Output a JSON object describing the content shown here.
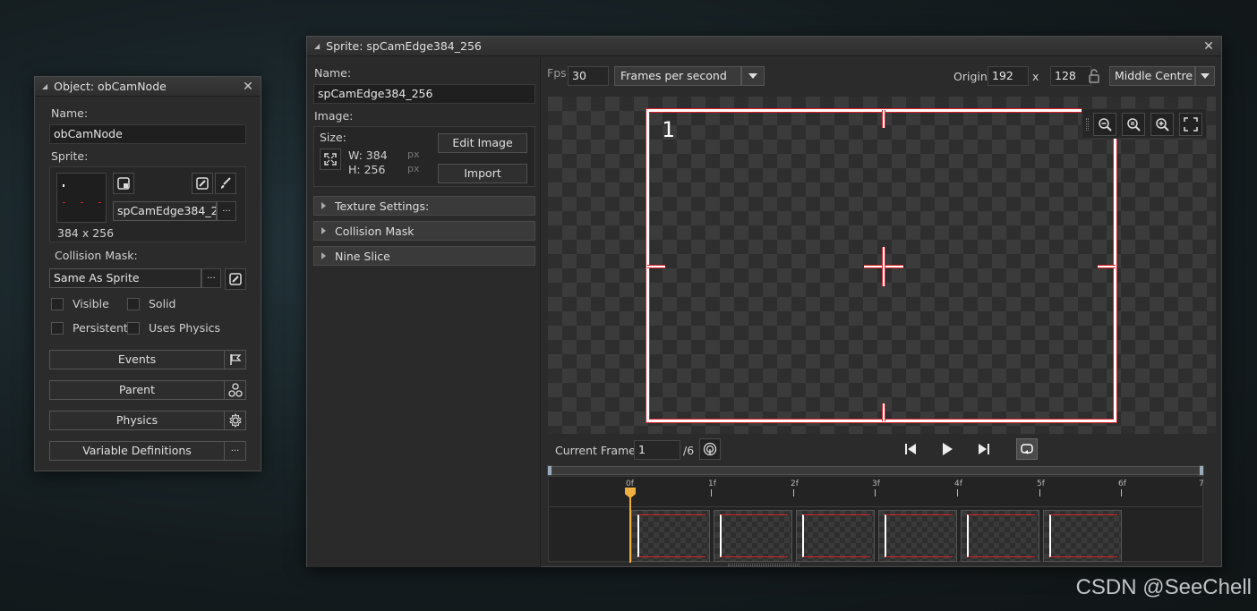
{
  "object_window": {
    "title": "Object: obCamNode",
    "name_label": "Name:",
    "name_value": "obCamNode",
    "sprite_label": "Sprite:",
    "sprite_name": "spCamEdge384_2...",
    "sprite_size": "384 x 256",
    "collision_mask_label": "Collision Mask:",
    "collision_mask_value": "Same As Sprite",
    "checkboxes": {
      "visible": "Visible",
      "solid": "Solid",
      "persistent": "Persistent",
      "uses_physics": "Uses Physics"
    },
    "buttons": {
      "events": "Events",
      "parent": "Parent",
      "physics": "Physics",
      "variable_definitions": "Variable Definitions"
    },
    "ellipsis": "···"
  },
  "sprite_window": {
    "title": "Sprite: spCamEdge384_256",
    "name_label": "Name:",
    "name_value": "spCamEdge384_256",
    "image_label": "Image:",
    "size_label": "Size:",
    "width_text": "W: 384",
    "height_text": "H: 256",
    "px_unit": "px",
    "edit_image": "Edit Image",
    "import": "Import",
    "sections": {
      "texture": "Texture Settings:",
      "collision": "Collision Mask",
      "nine_slice": "Nine Slice"
    },
    "fps_label": "Fps",
    "fps_value": "30",
    "fps_mode": "Frames per second",
    "origin_label": "Origin",
    "origin_x": "192",
    "origin_sep": "x",
    "origin_y": "128",
    "origin_preset": "Middle Centre",
    "frame_number": "1",
    "current_frame_label": "Current Frame:",
    "current_frame_value": "1",
    "frame_total": "/6",
    "timeline_labels": {
      "t0": "0f",
      "t1": "1f",
      "t2": "2f",
      "t3": "3f",
      "t4": "4f",
      "t5": "5f",
      "t6": "6f",
      "t7": "7"
    },
    "frame_count": 6,
    "current_frame_progress": 0
  },
  "watermark": "CSDN @SeeChell",
  "colors": {
    "accent_orange": "#f0b040",
    "sprite_red": "#d8202a",
    "panel_bg": "#2b2b2b"
  }
}
